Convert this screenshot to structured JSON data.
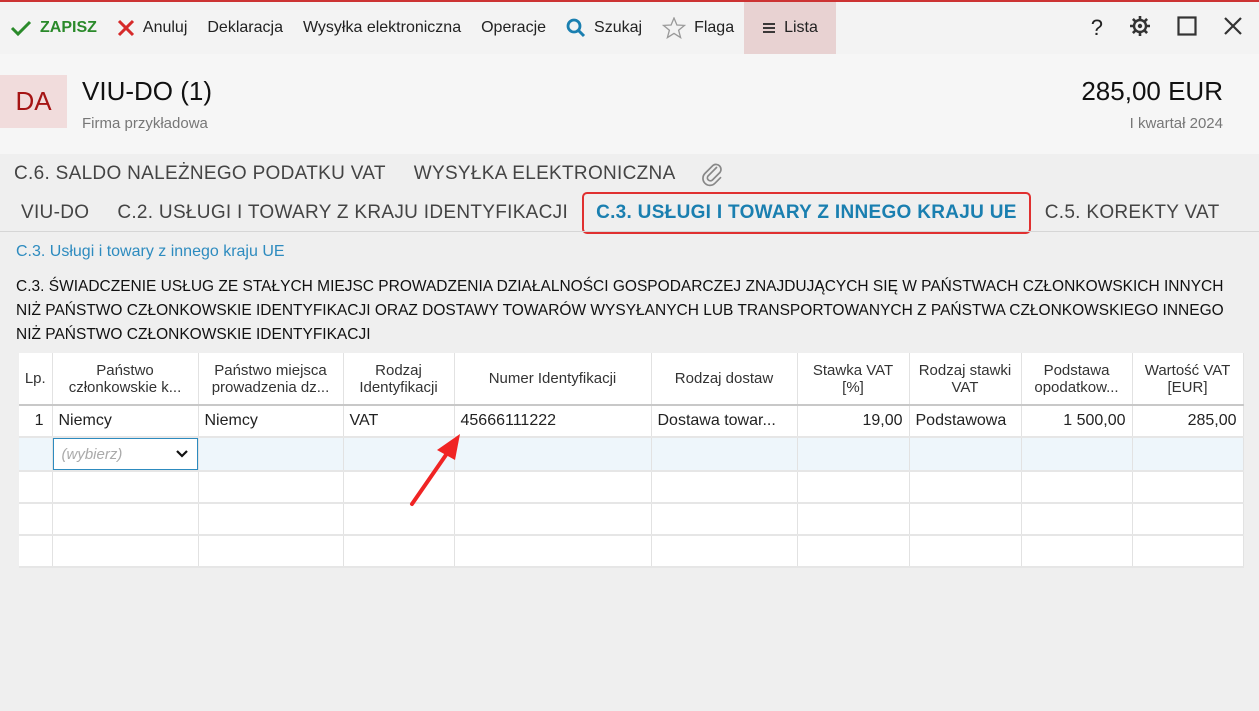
{
  "toolbar": {
    "save": "ZAPISZ",
    "cancel": "Anuluj",
    "declaration": "Deklaracja",
    "esend": "Wysyłka elektroniczna",
    "operations": "Operacje",
    "search": "Szukaj",
    "flag": "Flaga",
    "list": "Lista",
    "help": "?"
  },
  "header": {
    "badge": "DA",
    "title": "VIU-DO (1)",
    "company": "Firma przykładowa",
    "amount": "285,00 EUR",
    "period": "I kwartał 2024"
  },
  "tabs_row1": [
    "C.6. SALDO NALEŻNEGO PODATKU VAT",
    "WYSYŁKA ELEKTRONICZNA"
  ],
  "tabs_row2": [
    "VIU-DO",
    "C.2. USŁUGI I TOWARY Z KRAJU IDENTYFIKACJI",
    "C.3. USŁUGI I TOWARY Z INNEGO KRAJU UE",
    "C.5. KOREKTY VAT"
  ],
  "section": {
    "title": "C.3. Usługi i towary z innego kraju UE",
    "description": "C.3. ŚWIADCZENIE USŁUG ZE STAŁYCH MIEJSC PROWADZENIA DZIAŁALNOŚCI GOSPODARCZEJ ZNAJDUJĄCYCH SIĘ W PAŃSTWACH CZŁONKOWSKICH INNYCH NIŻ PAŃSTWO CZŁONKOWSKIE IDENTYFIKACJI ORAZ DOSTAWY TOWARÓW WYSYŁANYCH LUB TRANSPORTOWANYCH Z PAŃSTWA CZŁONKOWSKIEGO INNEGO NIŻ PAŃSTWO CZŁONKOWSKIE IDENTYFIKACJI"
  },
  "table": {
    "headers": [
      "Lp.",
      "Państwo członkowskie k...",
      "Państwo miejsca prowadzenia dz...",
      "Rodzaj Identyfikacji",
      "Numer Identyfikacji",
      "Rodzaj dostaw",
      "Stawka VAT [%]",
      "Rodzaj stawki VAT",
      "Podstawa opodatkow...",
      "Wartość VAT [EUR]"
    ],
    "row1": [
      "1",
      "Niemcy",
      "Niemcy",
      "VAT",
      "45666111222",
      "Dostawa towar...",
      "19,00",
      "Podstawowa",
      "1 500,00",
      "285,00"
    ],
    "dropdown_placeholder": "(wybierz)"
  },
  "colors": {
    "accent": "#2d8bbf",
    "save_green": "#2a8a2a",
    "highlight_red": "#e03030",
    "badge_text": "#a51414"
  }
}
